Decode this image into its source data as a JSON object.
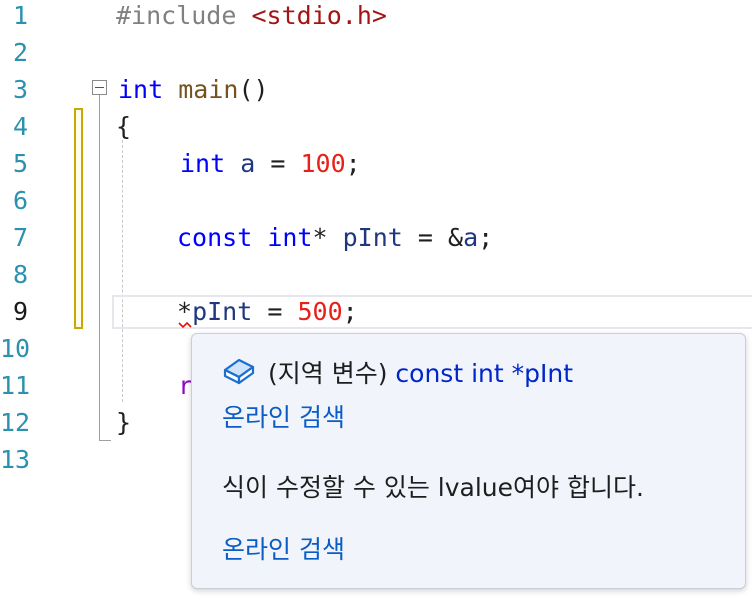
{
  "line_numbers": [
    "1",
    "2",
    "3",
    "4",
    "5",
    "6",
    "7",
    "8",
    "9",
    "10",
    "11",
    "12",
    "13"
  ],
  "code": {
    "line1": {
      "directive": "#include",
      "header": "<stdio.h>"
    },
    "line3": {
      "type": "int",
      "name": "main",
      "parens": "()"
    },
    "line4": {
      "brace": "{"
    },
    "line5": {
      "type": "int",
      "var": "a",
      "op": "=",
      "value": "100",
      "end": ";"
    },
    "line7": {
      "qual": "const",
      "type": "int",
      "star": "*",
      "var": "pInt",
      "op": "=",
      "amp": "&",
      "target": "a",
      "end": ";"
    },
    "line9": {
      "star": "*",
      "var": "pInt",
      "op": "=",
      "value": "500",
      "end": ";"
    },
    "line11": {
      "partial": "r"
    },
    "line12": {
      "brace": "}"
    }
  },
  "tooltip": {
    "symbol_kind": "(지역 변수)",
    "symbol_decl": "const int *pInt",
    "search_link_1": "온라인 검색",
    "error_message": "식이 수정할 수 있는 lvalue여야 합니다.",
    "search_link_2": "온라인 검색"
  },
  "colors": {
    "keyword": "#0000ff",
    "number": "#e8201a",
    "link": "#0b5cc4",
    "change_bar": "#c8a808"
  },
  "icons": {
    "fold": "collapse-minus-icon",
    "variable": "local-variable-icon",
    "error": "error-squiggle"
  }
}
